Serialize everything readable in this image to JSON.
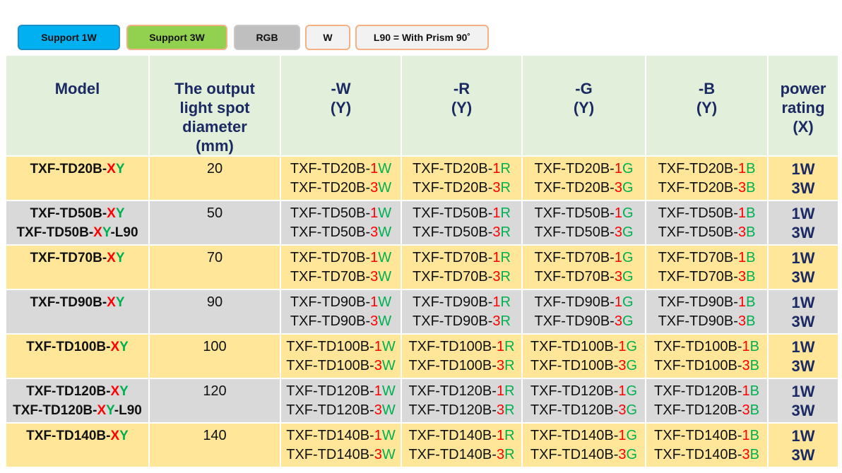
{
  "legend": {
    "items": [
      {
        "label": "Support 1W",
        "color": "#00b0f0"
      },
      {
        "label": "Support 3W",
        "color": "#92d050"
      },
      {
        "label": "RGB",
        "color": "#bfbfbf"
      },
      {
        "label": "W",
        "color": "#f2f2f2"
      },
      {
        "label": "L90 = With Prism 90˚",
        "color": "#f2f2f2"
      }
    ]
  },
  "colors": {
    "red": "#ff0000",
    "green": "#00b050",
    "navy": "#1b2a62",
    "row_yellow": "#ffe699",
    "row_gray": "#d9d9d9",
    "header_bg": "#e2efda"
  },
  "table": {
    "headers": [
      [
        "Model"
      ],
      [
        "The output",
        "light spot",
        "diameter",
        "(mm)"
      ],
      [
        "-W",
        "(Y)"
      ],
      [
        "-R",
        "(Y)"
      ],
      [
        "-G",
        "(Y)"
      ],
      [
        "-B",
        "(Y)"
      ],
      [
        "power",
        "rating",
        "(X)"
      ]
    ],
    "rows": [
      {
        "model": [
          [
            "TXF-TD20B-",
            "X",
            "Y",
            ""
          ]
        ],
        "diameter": "20",
        "variants": [
          [
            "TXF-TD20B-",
            "1",
            "W",
            "TXF-TD20B-",
            "3",
            "W"
          ],
          [
            "TXF-TD20B-",
            "1",
            "R",
            "TXF-TD20B-",
            "3",
            "R"
          ],
          [
            "TXF-TD20B-",
            "1",
            "G",
            "TXF-TD20B-",
            "3",
            "G"
          ],
          [
            "TXF-TD20B-",
            "1",
            "B",
            "TXF-TD20B-",
            "3",
            "B"
          ]
        ],
        "power": [
          "1W",
          "3W"
        ]
      },
      {
        "model": [
          [
            "TXF-TD50B-",
            "X",
            "Y",
            ""
          ],
          [
            "TXF-TD50B-",
            "X",
            "Y",
            "-L90"
          ]
        ],
        "diameter": "50",
        "variants": [
          [
            "TXF-TD50B-",
            "1",
            "W",
            "TXF-TD50B-",
            "3",
            "W"
          ],
          [
            "TXF-TD50B-",
            "1",
            "R",
            "TXF-TD50B-",
            "3",
            "R"
          ],
          [
            "TXF-TD50B-",
            "1",
            "G",
            "TXF-TD50B-",
            "3",
            "G"
          ],
          [
            "TXF-TD50B-",
            "1",
            "B",
            "TXF-TD50B-",
            "3",
            "B"
          ]
        ],
        "power": [
          "1W",
          "3W"
        ]
      },
      {
        "model": [
          [
            "TXF-TD70B-",
            "X",
            "Y",
            ""
          ]
        ],
        "diameter": "70",
        "variants": [
          [
            "TXF-TD70B-",
            "1",
            "W",
            "TXF-TD70B-",
            "3",
            "W"
          ],
          [
            "TXF-TD70B-",
            "1",
            "R",
            "TXF-TD70B-",
            "3",
            "R"
          ],
          [
            "TXF-TD70B-",
            "1",
            "G",
            "TXF-TD70B-",
            "3",
            "G"
          ],
          [
            "TXF-TD70B-",
            "1",
            "B",
            "TXF-TD70B-",
            "3",
            "B"
          ]
        ],
        "power": [
          "1W",
          "3W"
        ]
      },
      {
        "model": [
          [
            "TXF-TD90B-",
            "X",
            "Y",
            ""
          ]
        ],
        "diameter": "90",
        "variants": [
          [
            "TXF-TD90B-",
            "1",
            "W",
            "TXF-TD90B-",
            "3",
            "W"
          ],
          [
            "TXF-TD90B-",
            "1",
            "R",
            "TXF-TD90B-",
            "3",
            "R"
          ],
          [
            "TXF-TD90B-",
            "1",
            "G",
            "TXF-TD90B-",
            "3",
            "G"
          ],
          [
            "TXF-TD90B-",
            "1",
            "B",
            "TXF-TD90B-",
            "3",
            "B"
          ]
        ],
        "power": [
          "1W",
          "3W"
        ]
      },
      {
        "model": [
          [
            "TXF-TD100B-",
            "X",
            "Y",
            ""
          ]
        ],
        "diameter": "100",
        "variants": [
          [
            "TXF-TD100B-",
            "1",
            "W",
            "TXF-TD100B-",
            "3",
            "W"
          ],
          [
            "TXF-TD100B-",
            "1",
            "R",
            "TXF-TD100B-",
            "3",
            "R"
          ],
          [
            "TXF-TD100B-",
            "1",
            "G",
            "TXF-TD100B-",
            "3",
            "G"
          ],
          [
            "TXF-TD100B-",
            "1",
            "B",
            "TXF-TD100B-",
            "3",
            "B"
          ]
        ],
        "power": [
          "1W",
          "3W"
        ]
      },
      {
        "model": [
          [
            "TXF-TD120B-",
            "X",
            "Y",
            ""
          ],
          [
            "TXF-TD120B-",
            "X",
            "Y",
            "-L90"
          ]
        ],
        "diameter": "120",
        "variants": [
          [
            "TXF-TD120B-",
            "1",
            "W",
            "TXF-TD120B-",
            "3",
            "W"
          ],
          [
            "TXF-TD120B-",
            "1",
            "R",
            "TXF-TD120B-",
            "3",
            "R"
          ],
          [
            "TXF-TD120B-",
            "1",
            "G",
            "TXF-TD120B-",
            "3",
            "G"
          ],
          [
            "TXF-TD120B-",
            "1",
            "B",
            "TXF-TD120B-",
            "3",
            "B"
          ]
        ],
        "power": [
          "1W",
          "3W"
        ]
      },
      {
        "model": [
          [
            "TXF-TD140B-",
            "X",
            "Y",
            ""
          ]
        ],
        "diameter": "140",
        "variants": [
          [
            "TXF-TD140B-",
            "1",
            "W",
            "TXF-TD140B-",
            "3",
            "W"
          ],
          [
            "TXF-TD140B-",
            "1",
            "R",
            "TXF-TD140B-",
            "3",
            "R"
          ],
          [
            "TXF-TD140B-",
            "1",
            "G",
            "TXF-TD140B-",
            "3",
            "G"
          ],
          [
            "TXF-TD140B-",
            "1",
            "B",
            "TXF-TD140B-",
            "3",
            "B"
          ]
        ],
        "power": [
          "1W",
          "3W"
        ]
      }
    ]
  }
}
